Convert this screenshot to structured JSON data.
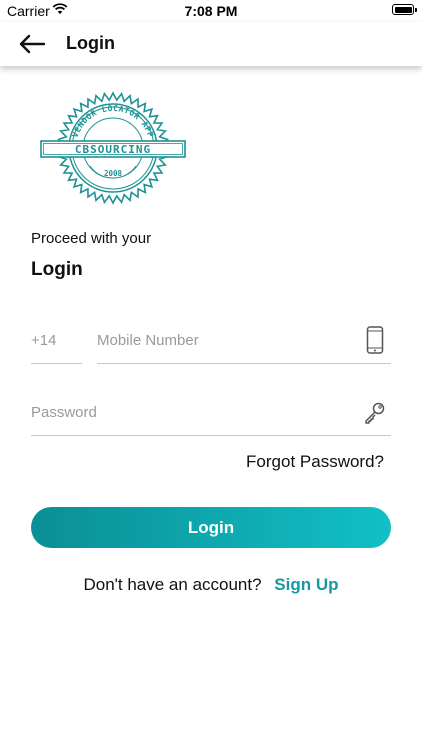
{
  "status_bar": {
    "carrier": "Carrier",
    "time": "7:08 PM",
    "wifi_icon": "wifi-icon",
    "battery_icon": "battery-icon"
  },
  "nav": {
    "back_icon": "arrow-left-icon",
    "title": "Login"
  },
  "logo": {
    "name": "CBSOURCING",
    "arc_text": "VENDOR LOCATOR APP",
    "year": "2008",
    "color": "#1e9294"
  },
  "form": {
    "proceed_text": "Proceed with your",
    "heading": "Login",
    "country_code_placeholder": "+14",
    "mobile_placeholder": "Mobile Number",
    "mobile_icon": "mobile-phone-icon",
    "password_placeholder": "Password",
    "password_icon": "key-icon",
    "forgot_password": "Forgot Password?",
    "login_button": "Login"
  },
  "signup": {
    "prompt": "Don't have an account?",
    "link": "Sign Up"
  },
  "colors": {
    "accent": "#17999e",
    "button_start": "#0a8f95",
    "button_end": "#11c0c6"
  }
}
